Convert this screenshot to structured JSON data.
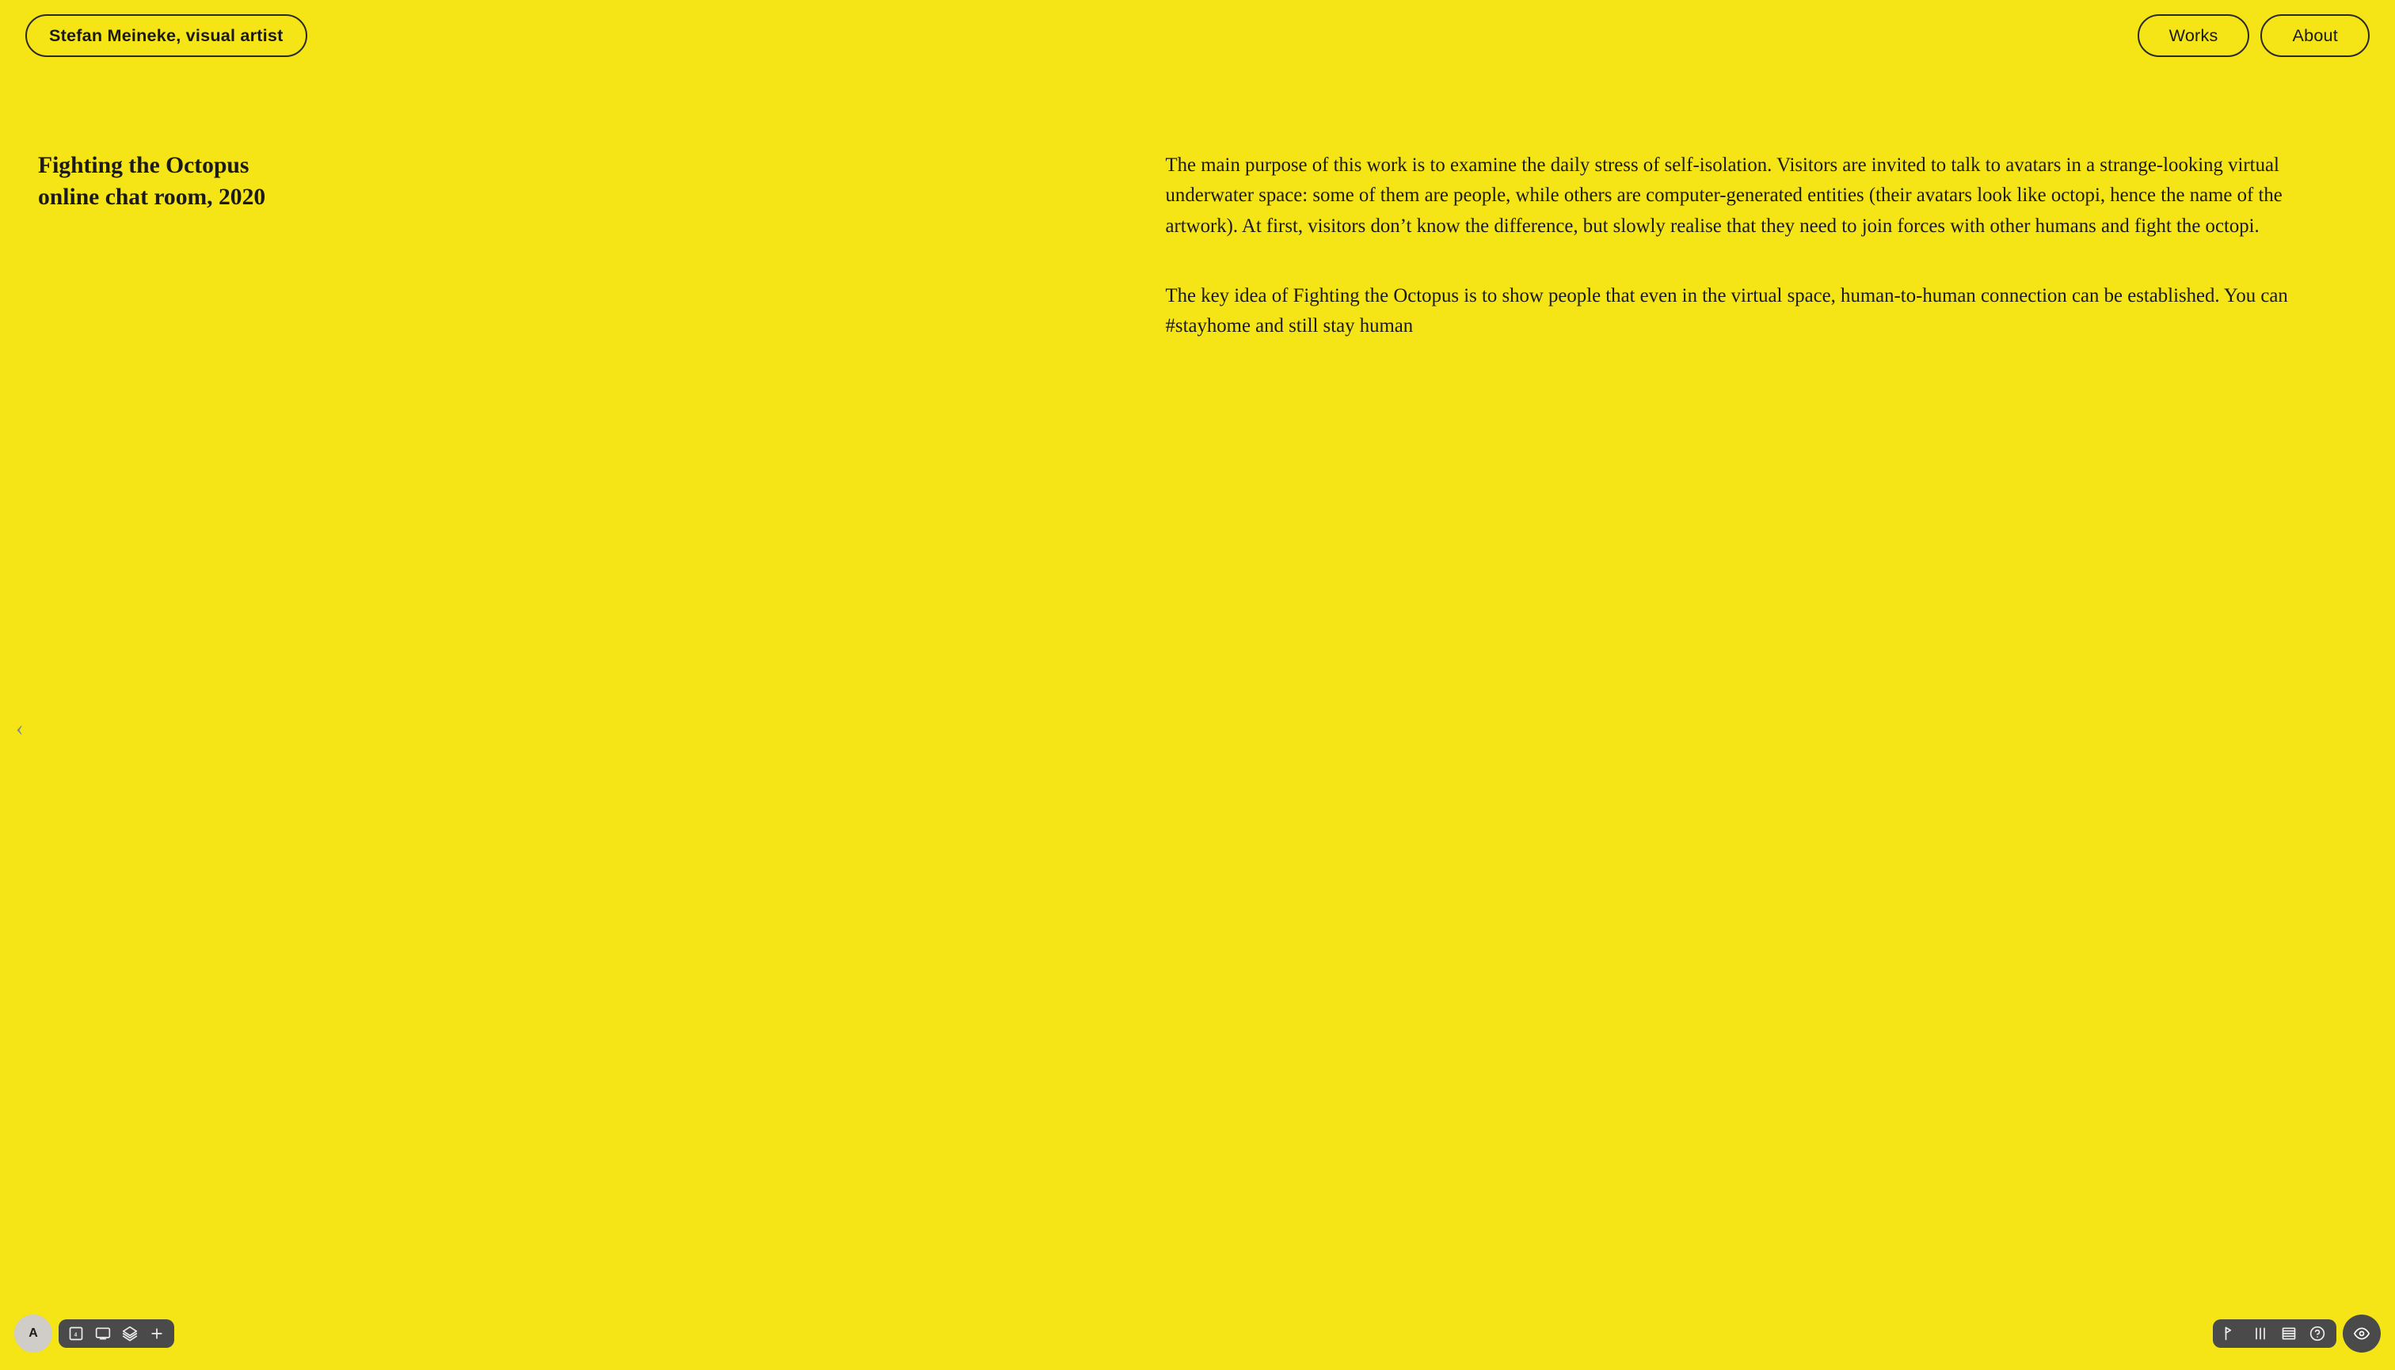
{
  "header": {
    "site_title": "Stefan Meineke, visual artist",
    "nav": {
      "works": "Works",
      "about": "About"
    }
  },
  "artwork": {
    "title_line1": "Fighting the Octopus",
    "title_line2": "online chat room, 2020",
    "description_p1": "The main purpose of this work is to examine the daily stress of self-isolation. Visitors are invited to talk to avatars in a strange-looking virtual underwater space: some of them are people, while others are computer-generated entities (their avatars look like octopi, hence the name of the artwork). At first, visitors don’t know the difference, but slowly realise that they need to join forces with other humans and fight the octopi.",
    "description_p2": "The key idea of Fighting the Octopus is to show people that even in the virtual space, human-to-human connection can be established. You can #stayhome and still stay human"
  },
  "bottom_toolbar_left": {
    "avatar_label": "A",
    "tools": [
      "frame",
      "screen",
      "layers",
      "plus"
    ]
  },
  "bottom_toolbar_right": {
    "tools": [
      "flag",
      "columns",
      "rows",
      "question"
    ],
    "eye_tool": "eye"
  },
  "colors": {
    "background": "#F5E416",
    "text_dark": "#1a1a1a",
    "toolbar_bg": "#4a4a4a",
    "border": "#2a2a2a",
    "arrow_color": "#aaaaaa"
  }
}
